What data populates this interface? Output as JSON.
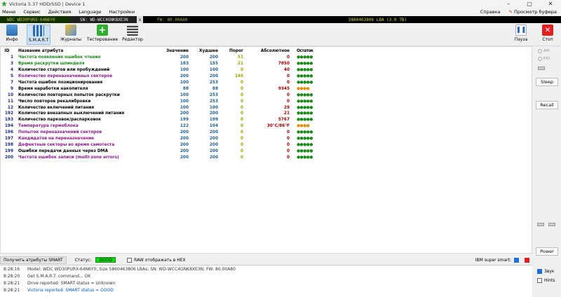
{
  "window": {
    "title": "Victoria 5.37 HDD/SSD | Device 1",
    "min": "–",
    "max": "▢",
    "close": "✕"
  },
  "menu": {
    "items": [
      "Меню",
      "Сервис",
      "Действия",
      "Language",
      "Настройки"
    ],
    "right": [
      "Справка",
      "Просмотр буфера"
    ]
  },
  "device": {
    "model": "WDC WD30PURX-64N6Y0",
    "serial": "SN: WD-WCC4GNK8XE3N",
    "close": "x",
    "fw": "FW: 80.00A80",
    "lba": "5860463806 LBA (3.0 TB)"
  },
  "toolbar": {
    "info": "Инфо",
    "smart": "S.M.A.R.T",
    "journals": "Журналы",
    "testing": "Тестирование",
    "editor": "Редактор",
    "pause": "Пауза",
    "stop": "Стоп"
  },
  "table": {
    "headers": [
      "ID",
      "Название атрибута",
      "Значение",
      "Худшее",
      "Порог",
      "Абсолютное",
      "Остаток"
    ],
    "rows": [
      {
        "id": "1",
        "name": "Частота появления ошибок чтения",
        "val": "200",
        "worst": "200",
        "thr": "51",
        "raw": "0",
        "rem": "●●●●●",
        "color": "#1a8a1a",
        "remColor": "#1a8a1a"
      },
      {
        "id": "3",
        "name": "Время раскрутки шпинделя",
        "val": "183",
        "worst": "155",
        "thr": "21",
        "raw": "7850",
        "rem": "●●●●●",
        "color": "#1a8a1a",
        "remColor": "#1a8a1a"
      },
      {
        "id": "4",
        "name": "Количество стартов или пробуждений",
        "val": "100",
        "worst": "100",
        "thr": "0",
        "raw": "40",
        "rem": "●●●●●",
        "color": "#000000",
        "remColor": "#1a8a1a"
      },
      {
        "id": "5",
        "name": "Количество переназначенных секторов",
        "val": "200",
        "worst": "200",
        "thr": "140",
        "raw": "0",
        "rem": "●●●●●",
        "color": "#8a1a8a",
        "remColor": "#1a8a1a"
      },
      {
        "id": "7",
        "name": "Частота ошибок позиционирования",
        "val": "100",
        "worst": "253",
        "thr": "0",
        "raw": "0",
        "rem": "●●●●●",
        "color": "#000000",
        "remColor": "#1a8a1a"
      },
      {
        "id": "9",
        "name": "Время наработки накопителя",
        "val": "88",
        "worst": "88",
        "thr": "0",
        "raw": "9345",
        "rem": "●●●●",
        "color": "#000000",
        "remColor": "#e09010"
      },
      {
        "id": "10",
        "name": "Количество повторных попыток раскрутки",
        "val": "100",
        "worst": "253",
        "thr": "0",
        "raw": "0",
        "rem": "●●●●●",
        "color": "#000000",
        "remColor": "#1a8a1a"
      },
      {
        "id": "11",
        "name": "Число повторов рекалибровки",
        "val": "100",
        "worst": "253",
        "thr": "0",
        "raw": "0",
        "rem": "●●●●●",
        "color": "#000000",
        "remColor": "#1a8a1a"
      },
      {
        "id": "12",
        "name": "Количество включений питания",
        "val": "100",
        "worst": "100",
        "thr": "0",
        "raw": "29",
        "rem": "●●●●●",
        "color": "#000000",
        "remColor": "#1a8a1a"
      },
      {
        "id": "192",
        "name": "Количество внезапных выключений питания",
        "val": "200",
        "worst": "200",
        "thr": "0",
        "raw": "21",
        "rem": "●●●●●",
        "color": "#000000",
        "remColor": "#1a8a1a"
      },
      {
        "id": "193",
        "name": "Количество парковок/распарковок",
        "val": "199",
        "worst": "199",
        "thr": "0",
        "raw": "5767",
        "rem": "●●●●●",
        "color": "#000000",
        "remColor": "#1a8a1a"
      },
      {
        "id": "194",
        "name": "Температура гермоблока",
        "val": "122",
        "worst": "104",
        "thr": "0",
        "raw": "30°C/86°F",
        "rem": "●●●●",
        "color": "#8a1a8a",
        "remColor": "#e09010"
      },
      {
        "id": "196",
        "name": "Попыток переназначений секторов",
        "val": "200",
        "worst": "200",
        "thr": "0",
        "raw": "0",
        "rem": "●●●●●",
        "color": "#8a1a8a",
        "remColor": "#1a8a1a"
      },
      {
        "id": "197",
        "name": "Кандидатов на переназначение",
        "val": "200",
        "worst": "200",
        "thr": "0",
        "raw": "0",
        "rem": "●●●●●",
        "color": "#8a1a8a",
        "remColor": "#1a8a1a"
      },
      {
        "id": "198",
        "name": "Дефектные секторы во время самотеста",
        "val": "200",
        "worst": "200",
        "thr": "0",
        "raw": "0",
        "rem": "●●●●●",
        "color": "#8a1a8a",
        "remColor": "#1a8a1a"
      },
      {
        "id": "199",
        "name": "Ошибки передачи данных через DMA",
        "val": "200",
        "worst": "200",
        "thr": "0",
        "raw": "0",
        "rem": "●●●●●",
        "color": "#000000",
        "remColor": "#1a8a1a"
      },
      {
        "id": "200",
        "name": "Частота ошибок записи (multi-zone errors)",
        "val": "200",
        "worst": "200",
        "thr": "0",
        "raw": "0",
        "rem": "●●●●●",
        "color": "#8a1a8a",
        "remColor": "#1a8a1a"
      }
    ]
  },
  "sidebar": {
    "api": "API",
    "pio": "PIO",
    "sleep": "Sleep",
    "recall": "Recall",
    "power": "Power"
  },
  "status": {
    "get_smart": "Получить атрибуты SMART",
    "label": "Статус:",
    "value": "GOOD",
    "raw_hex": "RAW отображать в HEX",
    "ibm": "IBM super smart:"
  },
  "log": [
    {
      "time": "8:28:16",
      "msg": "Model: WDC WD30PURX-64N6Y0; Size 5860463806 LBAs; SN: WD-WCC4GNK8XE3N; FW: 80.00A80",
      "blue": false
    },
    {
      "time": "8:28:20",
      "msg": "Get S.M.A.R.T. command... OK",
      "blue": false
    },
    {
      "time": "8:28:21",
      "msg": "Drive reported: SMART status = Unknown",
      "blue": false
    },
    {
      "time": "8:28:21",
      "msg": "Victoria reported: SMART status = GOOD",
      "blue": true
    }
  ],
  "bottom_right": {
    "sound": "Звук",
    "hints": "Hints"
  }
}
